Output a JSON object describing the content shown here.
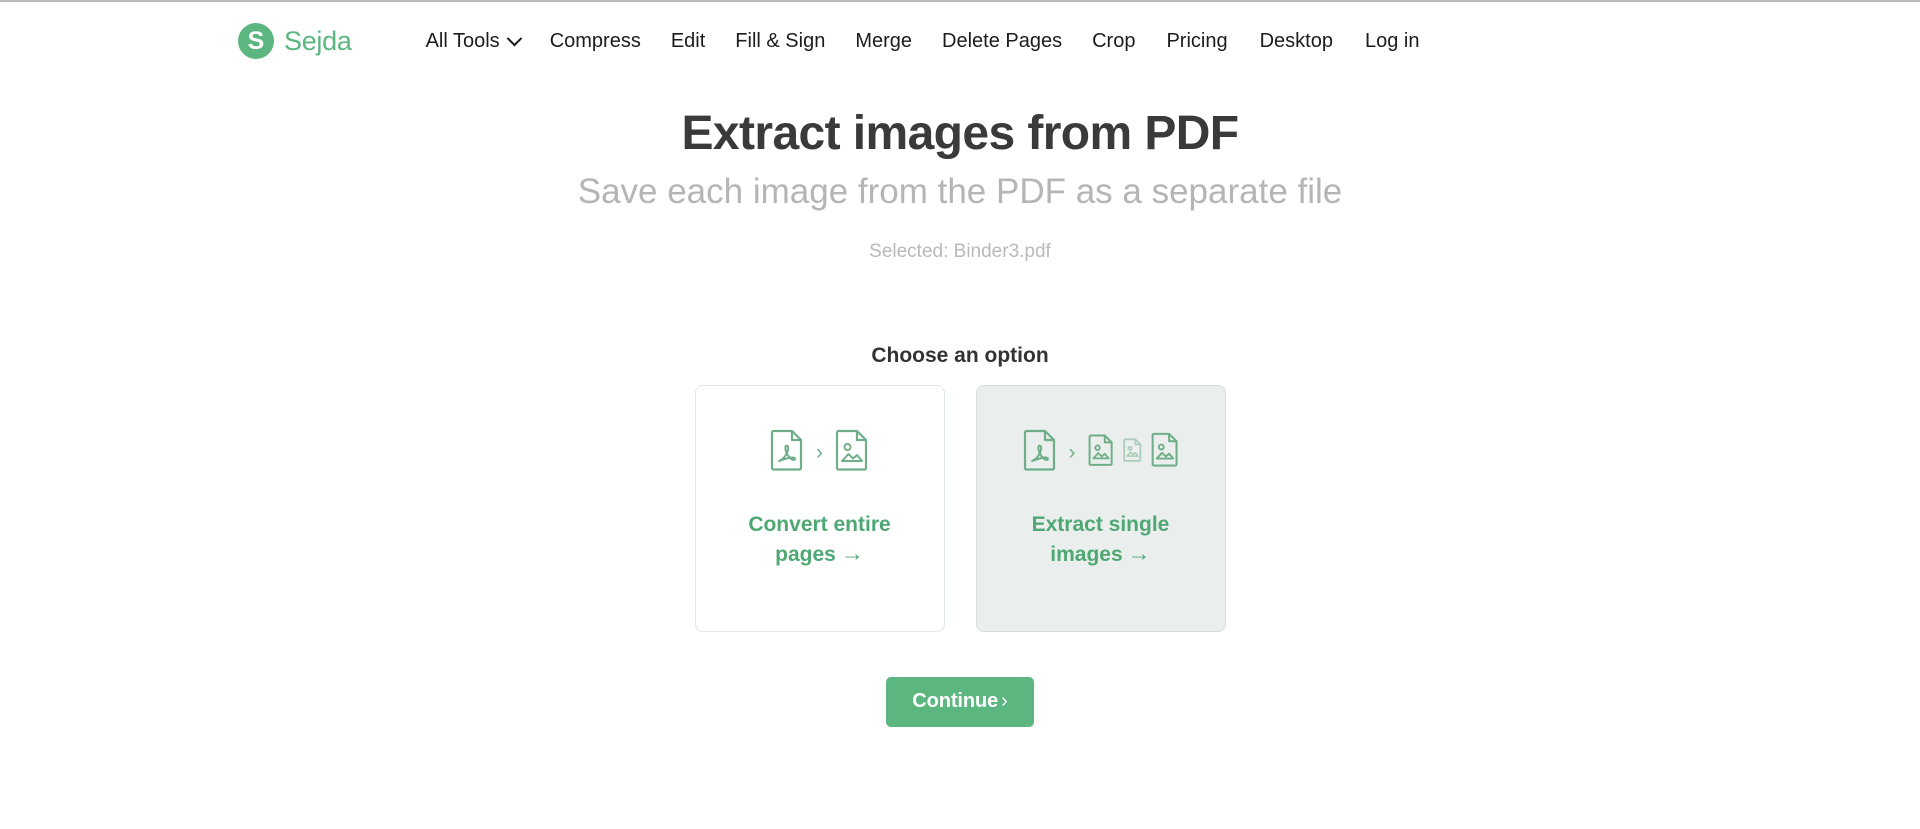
{
  "brand": {
    "mark": "S",
    "name": "Sejda",
    "color": "#5cb67f"
  },
  "nav": {
    "left_items": [
      {
        "label": "All Tools",
        "has_dropdown": true,
        "icon": "chevron-down-icon"
      },
      {
        "label": "Compress",
        "has_dropdown": false
      },
      {
        "label": "Edit",
        "has_dropdown": false
      },
      {
        "label": "Fill & Sign",
        "has_dropdown": false
      },
      {
        "label": "Merge",
        "has_dropdown": false
      },
      {
        "label": "Delete Pages",
        "has_dropdown": false
      },
      {
        "label": "Crop",
        "has_dropdown": false
      }
    ],
    "right_items": [
      {
        "label": "Pricing"
      },
      {
        "label": "Desktop"
      },
      {
        "label": "Log in"
      }
    ]
  },
  "main": {
    "title": "Extract images from PDF",
    "subtitle": "Save each image from the PDF as a separate file",
    "selected_file": "Selected: Binder3.pdf",
    "choose_label": "Choose an option",
    "options": [
      {
        "label_line1": "Convert entire",
        "label_line2": "pages",
        "arrow": "→",
        "selected": false,
        "icons": [
          "pdf-file-icon",
          "chevron-right-icon",
          "image-file-icon"
        ]
      },
      {
        "label_line1": "Extract single",
        "label_line2": "images",
        "arrow": "→",
        "selected": true,
        "icons": [
          "pdf-file-icon",
          "chevron-right-icon",
          "image-file-icon",
          "image-file-icon-small",
          "image-file-icon"
        ]
      }
    ],
    "continue_label": "Continue",
    "continue_chevron": "›"
  },
  "colors": {
    "accent_green": "#5cb67f",
    "card_green_text": "#4fa873",
    "selected_card_bg": "#eaefed",
    "card_border": "#dfe6e3",
    "muted_text": "#b5b5b5"
  }
}
